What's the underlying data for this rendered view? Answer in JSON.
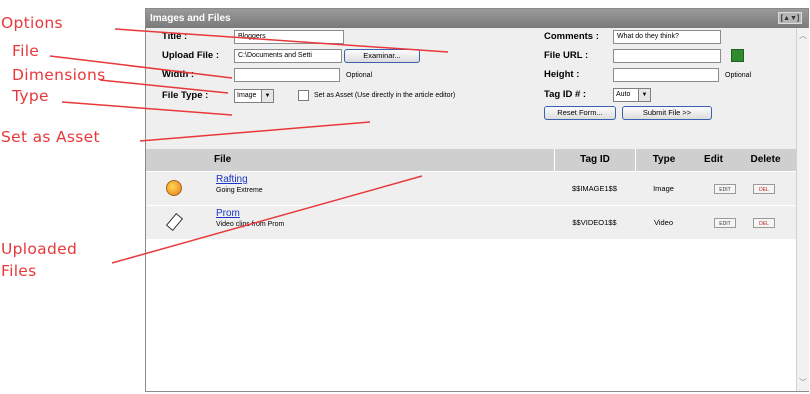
{
  "callouts": {
    "options": "Options",
    "file": "File",
    "dimensions": "Dimensions",
    "type": "Type",
    "asset": "Set as Asset",
    "uploaded": "Uploaded\nFiles"
  },
  "panel": {
    "title": "Images and Files",
    "window_button": "[▲▼]"
  },
  "form": {
    "title_label": "Title :",
    "title_value": "Bloggers",
    "upload_label": "Upload File :",
    "upload_value": "C:\\Documents and Setti",
    "browse_button": "Examinar...",
    "width_label": "Width :",
    "width_value": "",
    "width_optional": "Optional",
    "filetype_label": "File Type :",
    "filetype_value": "Image",
    "asset_text": "Set as Asset (Use directly in the article editor)",
    "comments_label": "Comments :",
    "comments_value": "What do they think?",
    "fileurl_label": "File URL :",
    "fileurl_value": "",
    "height_label": "Height :",
    "height_value": "",
    "height_optional": "Optional",
    "tagid_label": "Tag ID # :",
    "tagid_value": "Auto",
    "reset_button": "Reset Form...",
    "submit_button": "Submit File >>"
  },
  "table": {
    "headers": {
      "file": "File",
      "tagid": "Tag ID",
      "type": "Type",
      "edit": "Edit",
      "delete": "Delete"
    },
    "rows": [
      {
        "icon": "image-file-icon",
        "name": "Rafting",
        "description": "Going Extreme",
        "tagid": "$$IMAGE1$$",
        "type": "Image",
        "edit": "EDIT",
        "delete": "DEL"
      },
      {
        "icon": "video-file-icon",
        "name": "Prom",
        "description": "Video clips from Prom",
        "tagid": "$$VIDEO1$$",
        "type": "Video",
        "edit": "EDIT",
        "delete": "DEL"
      }
    ]
  },
  "colors": {
    "callout": "#e8383b",
    "titlebar": "#8a8a8a",
    "link": "#1a35c8",
    "button_border": "#3a5fb0"
  }
}
